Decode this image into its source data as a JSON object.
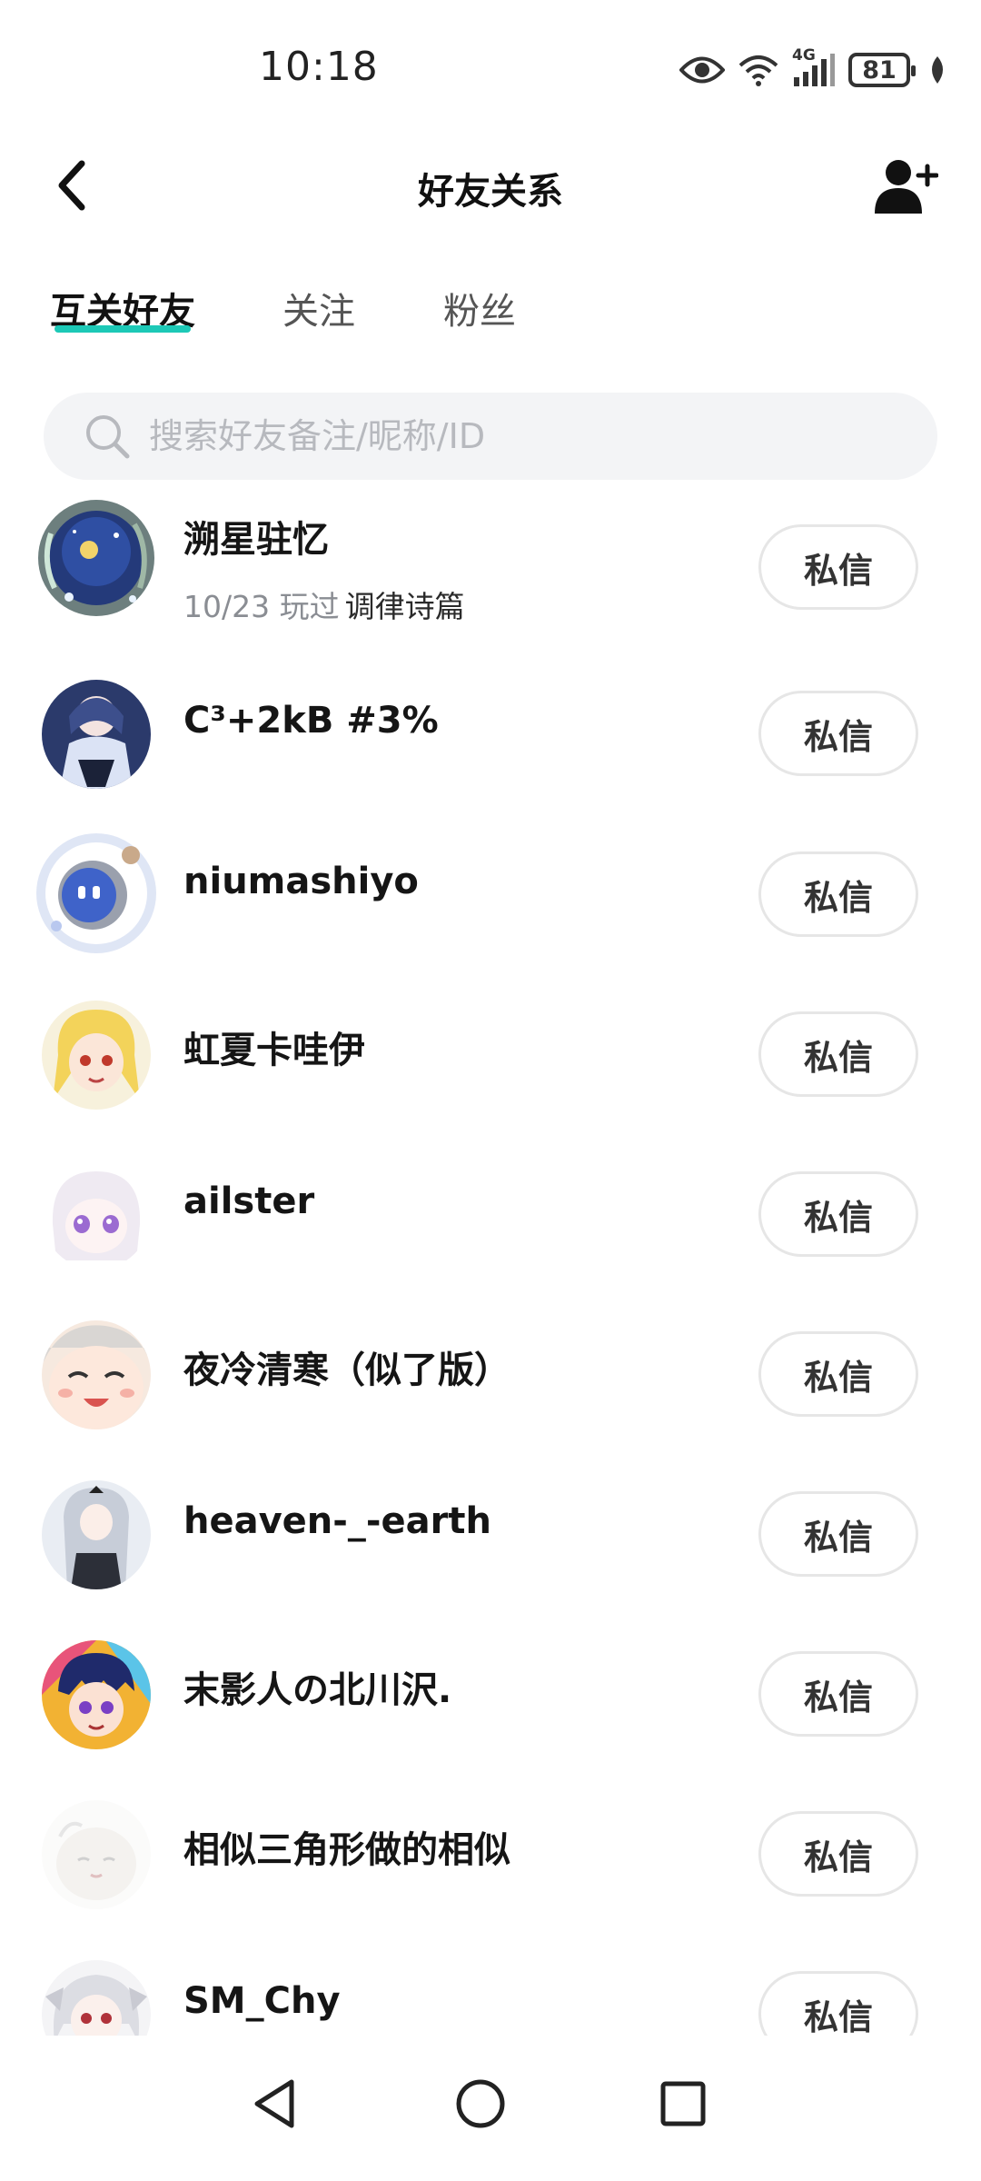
{
  "status_bar": {
    "time": "10:18",
    "network": "4G",
    "battery": "81",
    "icons": [
      "eye-icon",
      "wifi-icon",
      "signal-icon",
      "battery-icon",
      "leaf-icon"
    ]
  },
  "header": {
    "title": "好友关系",
    "back_icon": "chevron-left-icon",
    "add_icon": "add-user-icon"
  },
  "tabs": [
    {
      "label": "互关好友",
      "active": true
    },
    {
      "label": "关注",
      "active": false
    },
    {
      "label": "粉丝",
      "active": false
    }
  ],
  "search": {
    "placeholder": "搜索好友备注/昵称/ID",
    "value": ""
  },
  "friends": [
    {
      "name": "溯星驻忆",
      "played_date": "10/23 玩过",
      "game": "调律诗篇",
      "button": "私信"
    },
    {
      "name": "C³+2kB #3%",
      "button": "私信"
    },
    {
      "name": "niumashiyo",
      "button": "私信"
    },
    {
      "name": "虹夏卡哇伊",
      "button": "私信"
    },
    {
      "name": "ailster",
      "button": "私信"
    },
    {
      "name": "夜冷清寒（似了版）",
      "button": "私信"
    },
    {
      "name": "heaven-_-earth",
      "button": "私信"
    },
    {
      "name": "末影人の北川沢.",
      "button": "私信"
    },
    {
      "name": "相似三角形做的相似",
      "button": "私信"
    },
    {
      "name": "SM_Chy",
      "button": "私信"
    }
  ],
  "nav_bar": {
    "icons": [
      "back-triangle-icon",
      "home-circle-icon",
      "recents-square-icon"
    ]
  },
  "colors": {
    "accent": "#1dc9b7",
    "search_bg": "#f3f4f6",
    "button_border": "#e6e6e6"
  }
}
